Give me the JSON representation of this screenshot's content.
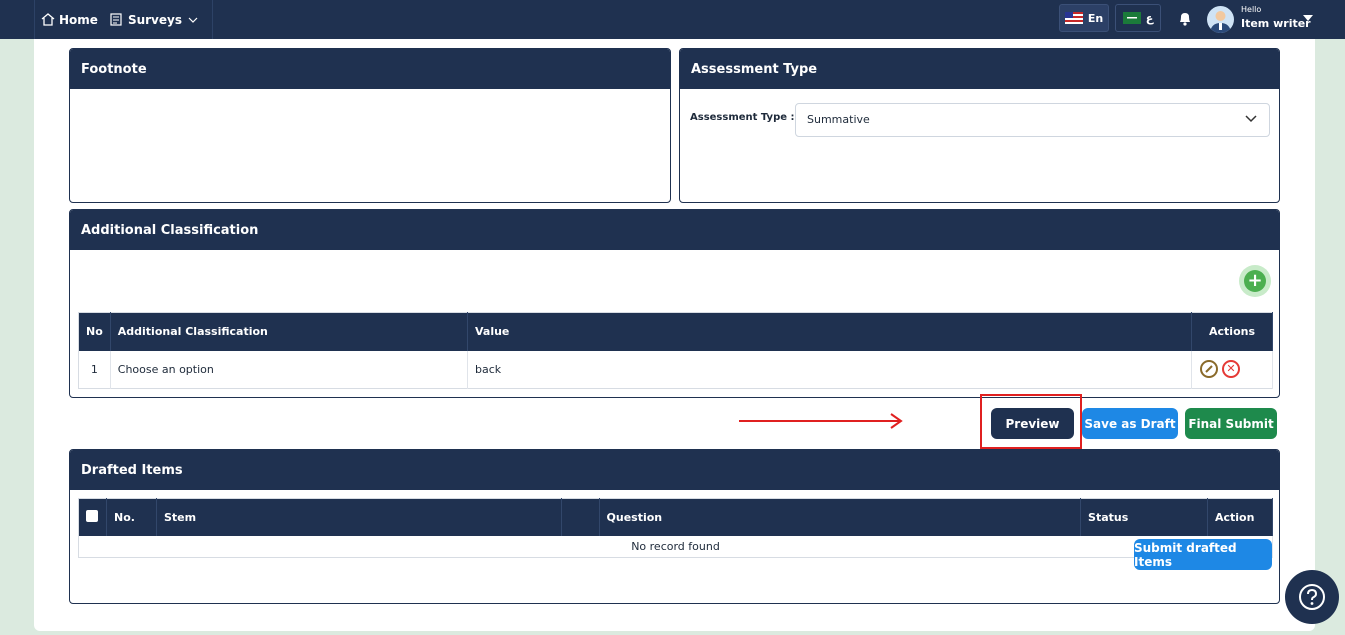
{
  "nav": {
    "home": "Home",
    "surveys": "Surveys",
    "lang_en": "En",
    "lang_ar": "ع",
    "greeting": "Hello",
    "user": "Item writer"
  },
  "footnote": {
    "title": "Footnote"
  },
  "assessment": {
    "title": "Assessment Type",
    "label": "Assessment Type :",
    "value": "Summative"
  },
  "classification": {
    "title": "Additional Classification",
    "columns": [
      "No",
      "Additional Classification",
      "Value",
      "Actions"
    ],
    "rows": [
      {
        "no": "1",
        "classification": "Choose an option",
        "value": "back"
      }
    ]
  },
  "actions": {
    "preview": "Preview",
    "save_draft": "Save as Draft",
    "final_submit": "Final Submit"
  },
  "drafts": {
    "title": "Drafted Items",
    "columns": [
      "No.",
      "Stem",
      "Question",
      "Status",
      "Action"
    ],
    "empty": "No record found",
    "submit": "Submit drafted Items"
  },
  "colors": {
    "navy": "#1f3150",
    "blue": "#1e88e5",
    "green": "#1e8a4c",
    "highlight": "#e02020"
  }
}
